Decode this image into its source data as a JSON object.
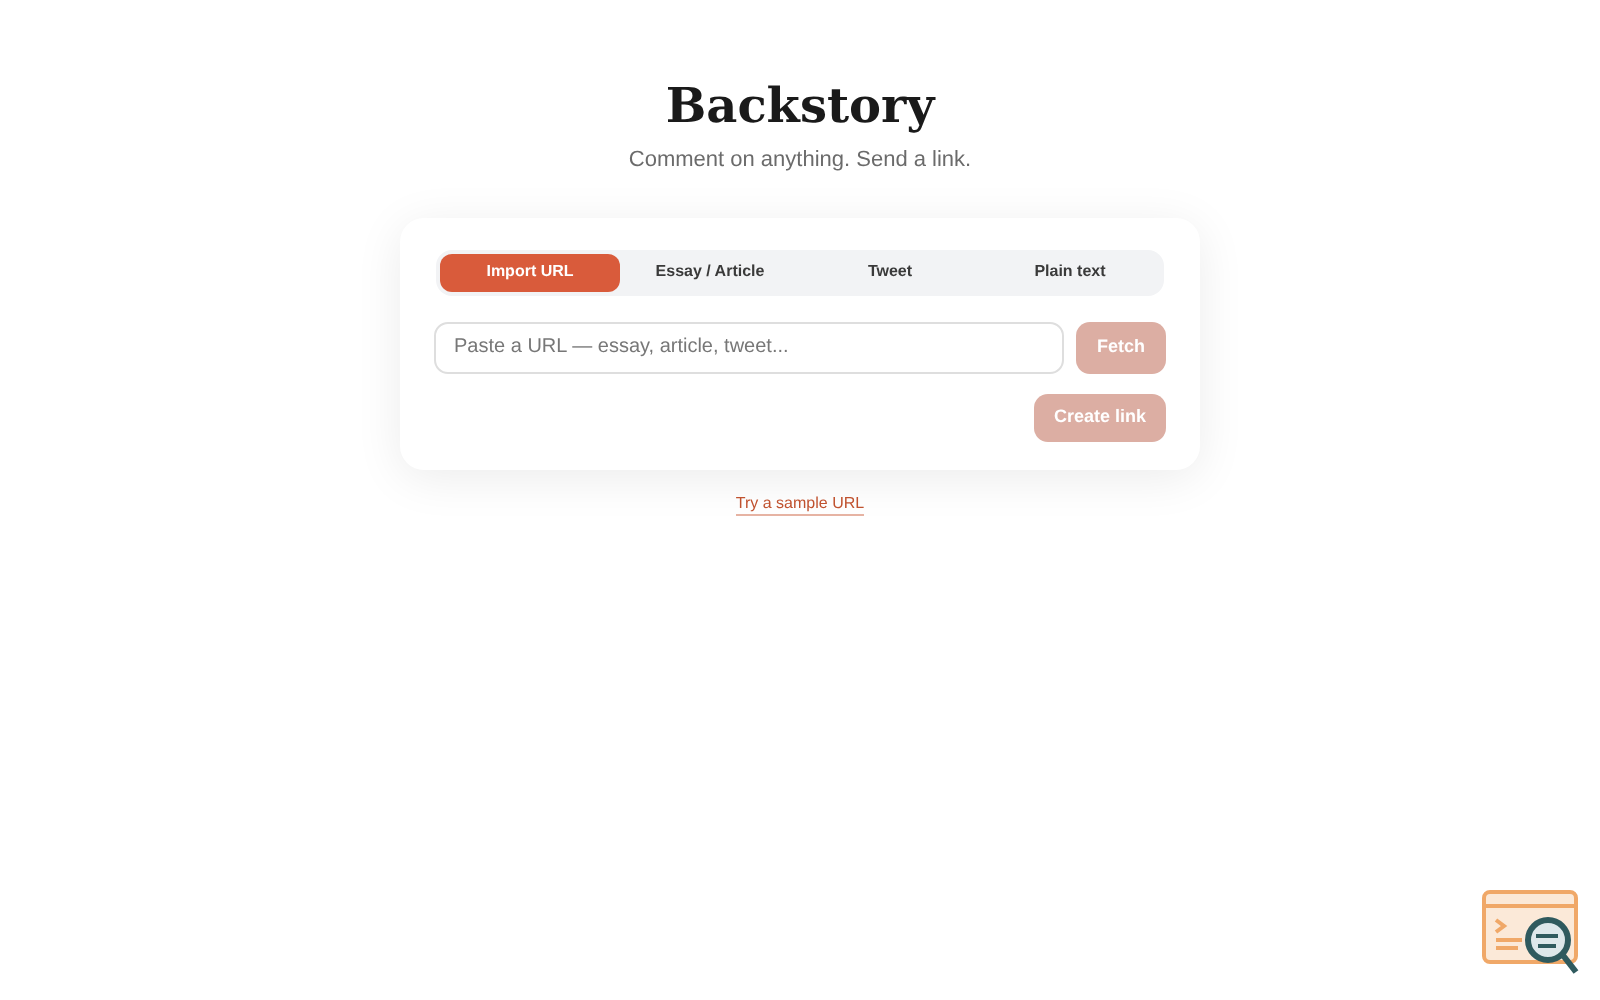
{
  "title": "Backstory",
  "subtitle": "Comment on anything. Send a link.",
  "tabs": [
    {
      "label": "Import URL",
      "selected": true
    },
    {
      "label": "Essay / Article",
      "selected": false
    },
    {
      "label": "Tweet",
      "selected": false
    },
    {
      "label": "Plain text",
      "selected": false
    }
  ],
  "url_field": {
    "placeholder": "Paste a URL — essay, article, tweet..."
  },
  "fetch_button": {
    "label": "Fetch",
    "disabled": true
  },
  "create_button": {
    "label": "Create link",
    "disabled": true
  },
  "sample_link": "Try a sample URL"
}
